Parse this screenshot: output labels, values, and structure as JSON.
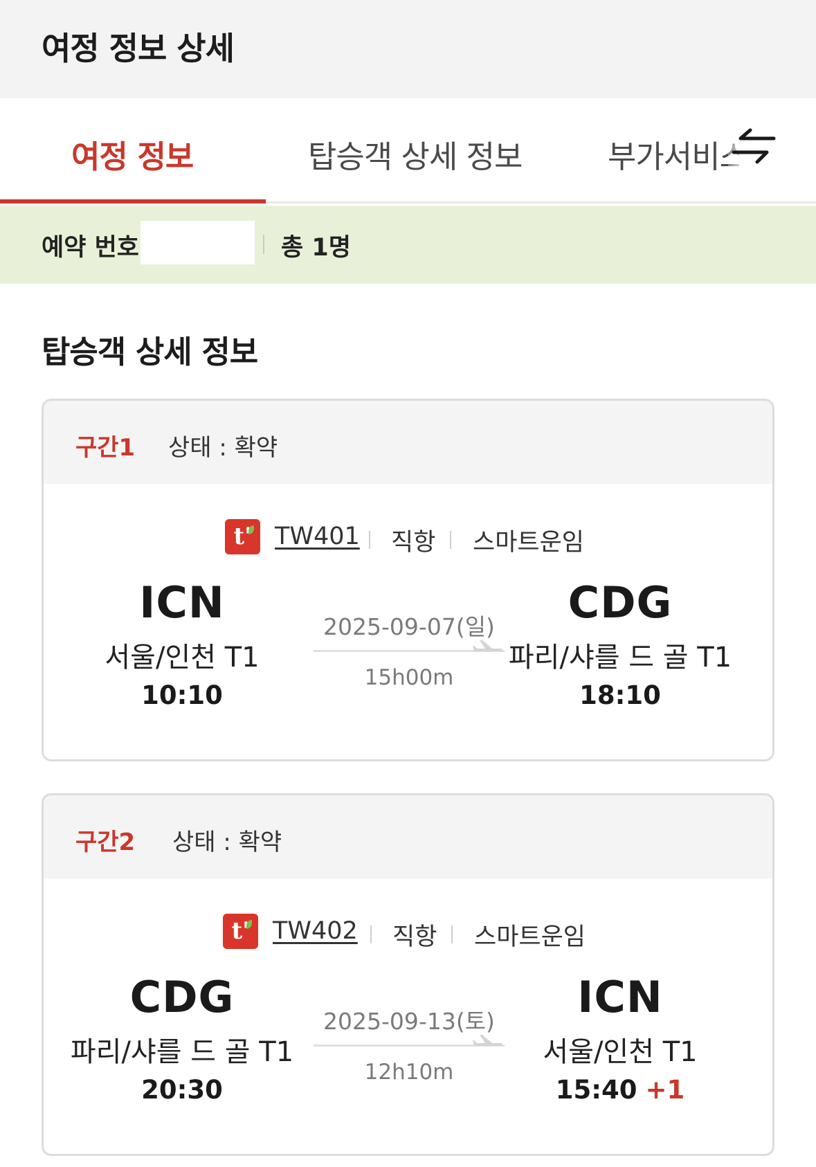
{
  "header": {
    "title": "여정 정보 상세"
  },
  "tabs": [
    {
      "label": "여정 정보",
      "active": true
    },
    {
      "label": "탑승객 상세 정보",
      "active": false
    },
    {
      "label": "부가서비스",
      "active": false
    }
  ],
  "tab_scroll_icon": "swap-arrows-icon",
  "reservation": {
    "number_label": "예약 번호",
    "total": "총 1명"
  },
  "section_title": "탑승객 상세 정보",
  "segments": [
    {
      "label": "구간1",
      "status": "상태 : 확약",
      "airline_logo": "t'",
      "flight_no": "TW401",
      "type": "직항",
      "fare": "스마트운임",
      "date": "2025-09-07(일)",
      "duration": "15h00m",
      "origin": {
        "code": "ICN",
        "city": "서울/인천 T1",
        "time": "10:10"
      },
      "destination": {
        "code": "CDG",
        "city": "파리/샤를 드 골 T1",
        "time": "18:10",
        "day_offset": ""
      }
    },
    {
      "label": "구간2",
      "status": "상태 : 확약",
      "airline_logo": "t'",
      "flight_no": "TW402",
      "type": "직항",
      "fare": "스마트운임",
      "date": "2025-09-13(토)",
      "duration": "12h10m",
      "origin": {
        "code": "CDG",
        "city": "파리/샤를 드 골 T1",
        "time": "20:30"
      },
      "destination": {
        "code": "ICN",
        "city": "서울/인천 T1",
        "time": "15:40",
        "day_offset": "+1"
      }
    }
  ],
  "colors": {
    "accent": "#c8382b",
    "reservation_bg": "#e8f1d8",
    "header_bg": "#f3f3f3",
    "airline_logo": "#d9352a"
  }
}
